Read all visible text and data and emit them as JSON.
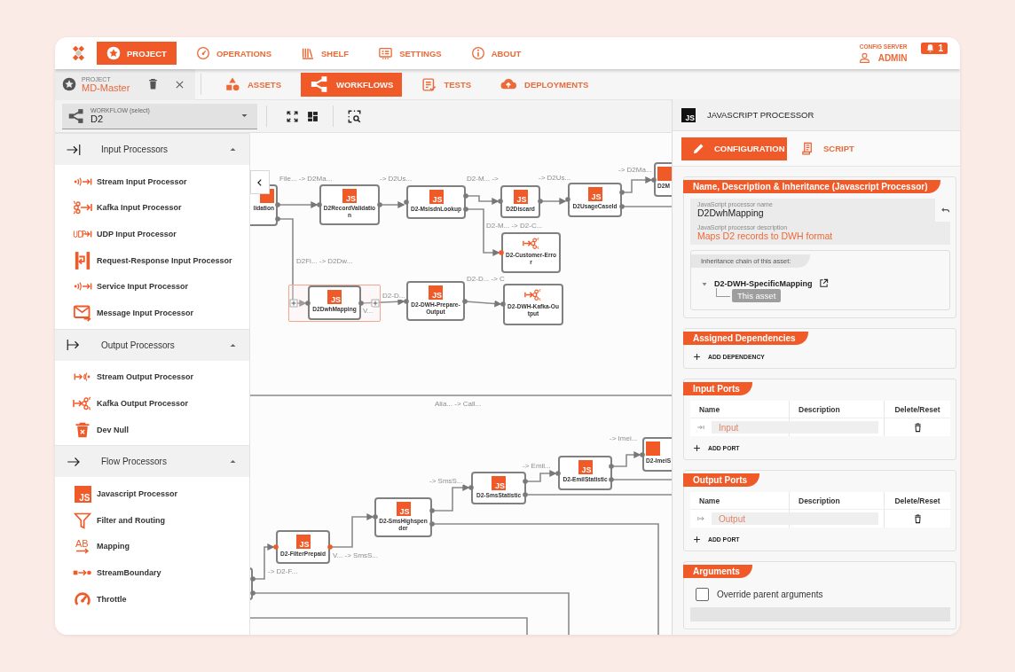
{
  "top_nav": {
    "tabs": [
      {
        "label": "PROJECT",
        "selected": true
      },
      {
        "label": "OPERATIONS",
        "selected": false
      },
      {
        "label": "SHELF",
        "selected": false
      },
      {
        "label": "SETTINGS",
        "selected": false
      },
      {
        "label": "ABOUT",
        "selected": false
      }
    ],
    "server_label": "CONFIG SERVER",
    "user": "ADMIN",
    "notifications": "1"
  },
  "sub_nav": {
    "project_label": "PROJECT",
    "project_name": "MD-Master",
    "tabs": [
      {
        "label": "ASSETS",
        "selected": false
      },
      {
        "label": "WORKFLOWS",
        "selected": true
      },
      {
        "label": "TESTS",
        "selected": false
      },
      {
        "label": "DEPLOYMENTS",
        "selected": false
      }
    ]
  },
  "workflow_select": {
    "label": "WORKFLOW (select)",
    "value": "D2"
  },
  "sidebar": {
    "sections": [
      {
        "title": "Input Processors",
        "expanded": true,
        "items": [
          {
            "label": "Stream Input Processor"
          },
          {
            "label": "Kafka Input Processor"
          },
          {
            "label": "UDP Input Processor"
          },
          {
            "label": "Request-Response Input Processor"
          },
          {
            "label": "Service Input Processor"
          },
          {
            "label": "Message Input Processor"
          }
        ]
      },
      {
        "title": "Output Processors",
        "expanded": true,
        "items": [
          {
            "label": "Stream Output Processor"
          },
          {
            "label": "Kafka Output Processor"
          },
          {
            "label": "Dev Null"
          }
        ]
      },
      {
        "title": "Flow Processors",
        "expanded": true,
        "items": [
          {
            "label": "Javascript Processor",
            "icon_text": "JS"
          },
          {
            "label": "Filter and Routing"
          },
          {
            "label": "Mapping",
            "icon_text": "AB"
          },
          {
            "label": "StreamBoundary"
          },
          {
            "label": "Throttle"
          }
        ]
      }
    ]
  },
  "canvas": {
    "nodes": [
      {
        "kind": "js",
        "label": "lidation",
        "selected": false,
        "active": false
      },
      {
        "kind": "js",
        "label": "D2RecordValidation",
        "badge": "JS",
        "selected": false,
        "active": false
      },
      {
        "kind": "js",
        "label": "D2-MsisdnLookup",
        "badge": "JS",
        "selected": false,
        "active": false
      },
      {
        "kind": "js",
        "label": "D2Discard",
        "badge": "JS",
        "selected": false,
        "active": false
      },
      {
        "kind": "js",
        "label": "D2UsageCaseId",
        "badge": "JS",
        "selected": false,
        "active": false
      },
      {
        "kind": "js",
        "label": "D2M",
        "selected": false,
        "active": false
      },
      {
        "kind": "kafka",
        "label": "D2-Customer-Error",
        "selected": false,
        "active": true
      },
      {
        "kind": "js",
        "label": "D2DwhMapping",
        "badge": "JS",
        "selected": true,
        "active": false
      },
      {
        "kind": "js",
        "label": "D2-DWH-Prepare-Output",
        "badge": "JS",
        "selected": false,
        "active": false
      },
      {
        "kind": "kafka",
        "label": "D2-DWH-Kafka-Output",
        "selected": false,
        "active": false
      },
      {
        "kind": "js",
        "label": "D2-ImeiS",
        "selected": false,
        "active": false
      },
      {
        "kind": "js",
        "label": "D2-EmilStatistic",
        "badge": "JS",
        "selected": false,
        "active": false
      },
      {
        "kind": "js",
        "label": "D2-SmsStatistic",
        "badge": "JS",
        "selected": false,
        "active": false
      },
      {
        "kind": "js",
        "label": "D2-SmsHighspender",
        "badge": "JS",
        "selected": false,
        "active": false
      },
      {
        "kind": "js",
        "label": "D2-FilterPrepaid",
        "badge": "JS",
        "selected": false,
        "active": true
      },
      {
        "kind": "js",
        "selected": false,
        "active": false
      }
    ],
    "edge_labels": [
      "File... -> D2Ma...",
      "-> D2Us...",
      "D2-M... ->",
      "-> D2Us...",
      "-> D2Ma...",
      "D2-M... -> D2-C...",
      "D2Fi... -> D2Dw...",
      "V...",
      "D2-D...",
      "D2-D... -> C",
      "Alia... -> Call...",
      "-> Imei...",
      "-> Emil...",
      "-> SmsS...",
      "V... -> SmsS...",
      "-> D2-F..."
    ]
  },
  "properties": {
    "header_badge": "JS",
    "title": "JAVASCRIPT PROCESSOR",
    "tabs": [
      {
        "label": "CONFIGURATION",
        "selected": true
      },
      {
        "label": "SCRIPT",
        "selected": false
      }
    ],
    "general": {
      "title": "Name, Description & Inheritance (Javascript Processor)",
      "name_label": "JavaScript processor name",
      "name_value": "D2DwhMapping",
      "description_label": "JavaScript processor description",
      "description_value": "Maps D2 records to DWH format",
      "inheritance_title": "Inheritance chain of this asset:",
      "inheritance": [
        {
          "label": "D2-DWH-SpecificMapping",
          "expanded": true,
          "current": false,
          "children": [
            {
              "label": "This asset",
              "current": true
            }
          ]
        }
      ]
    },
    "dependencies": {
      "title": "Assigned Dependencies",
      "add_label": "ADD DEPENDENCY"
    },
    "input_ports": {
      "title": "Input Ports",
      "columns": [
        "Name",
        "Description",
        "Delete/Reset"
      ],
      "rows": [
        {
          "name": "Input"
        }
      ],
      "add_label": "ADD PORT"
    },
    "output_ports": {
      "title": "Output Ports",
      "columns": [
        "Name",
        "Description",
        "Delete/Reset"
      ],
      "rows": [
        {
          "name": "Output"
        }
      ],
      "add_label": "ADD PORT"
    },
    "arguments": {
      "title": "Arguments",
      "override_label": "Override parent arguments",
      "override_checked": false
    }
  }
}
